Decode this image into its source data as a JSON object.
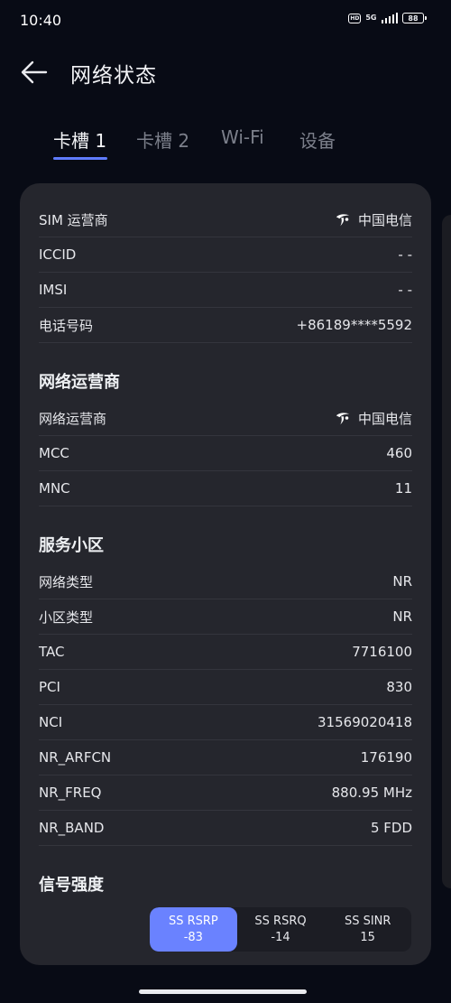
{
  "status_bar": {
    "time": "10:40",
    "hd": "HD",
    "network": "5G",
    "battery": "88"
  },
  "header": {
    "title": "网络状态"
  },
  "tabs": [
    {
      "label": "卡槽 1",
      "active": true
    },
    {
      "label": "卡槽 2",
      "active": false
    },
    {
      "label": "Wi-Fi",
      "active": false
    },
    {
      "label": "设备",
      "active": false
    }
  ],
  "sim": {
    "operator": {
      "label": "SIM 运营商",
      "value": "中国电信"
    },
    "iccid": {
      "label": "ICCID",
      "value": "- -"
    },
    "imsi": {
      "label": "IMSI",
      "value": "- -"
    },
    "phone": {
      "label": "电话号码",
      "value": "+86189****5592"
    }
  },
  "network_operator": {
    "title": "网络运营商",
    "operator": {
      "label": "网络运营商",
      "value": "中国电信"
    },
    "mcc": {
      "label": "MCC",
      "value": "460"
    },
    "mnc": {
      "label": "MNC",
      "value": "11"
    }
  },
  "serving_cell": {
    "title": "服务小区",
    "rows": [
      {
        "label": "网络类型",
        "value": "NR"
      },
      {
        "label": "小区类型",
        "value": "NR"
      },
      {
        "label": "TAC",
        "value": "7716100"
      },
      {
        "label": "PCI",
        "value": "830"
      },
      {
        "label": "NCI",
        "value": "31569020418"
      },
      {
        "label": "NR_ARFCN",
        "value": "176190"
      },
      {
        "label": "NR_FREQ",
        "value": "880.95 MHz"
      },
      {
        "label": "NR_BAND",
        "value": "5 FDD"
      }
    ]
  },
  "signal": {
    "title": "信号强度",
    "tabs": [
      {
        "label": "SS RSRP",
        "value": "-83",
        "active": true
      },
      {
        "label": "SS RSRQ",
        "value": "-14",
        "active": false
      },
      {
        "label": "SS SINR",
        "value": "15",
        "active": false
      }
    ]
  },
  "colors": {
    "background": "#080b15",
    "card": "#25262d",
    "accent": "#6a82ff",
    "tab_indicator": "#5f7cff"
  }
}
